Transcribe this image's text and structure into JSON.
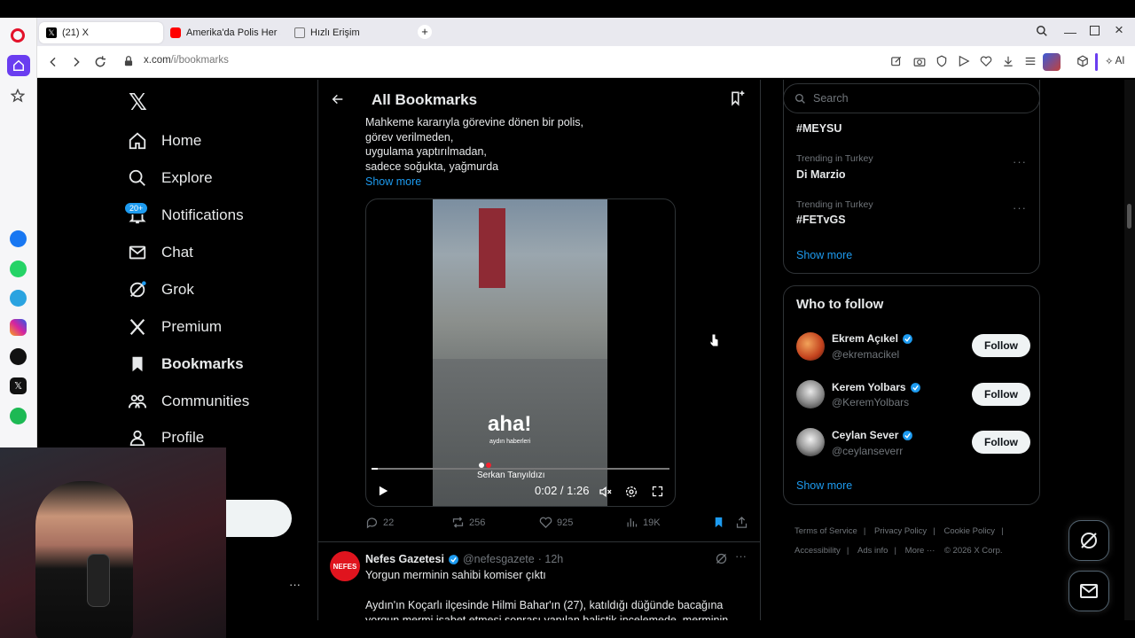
{
  "browser": {
    "tabs": [
      {
        "label": "(21) X"
      },
      {
        "label": "Amerika'da Polis Her Şeyi"
      },
      {
        "label": "Hızlı Erişim"
      }
    ],
    "url_host": "x.com",
    "url_path": "/i/bookmarks",
    "ai_label": "AI"
  },
  "nav": {
    "items": [
      {
        "label": "Home"
      },
      {
        "label": "Explore"
      },
      {
        "label": "Notifications"
      },
      {
        "label": "Chat"
      },
      {
        "label": "Grok"
      },
      {
        "label": "Premium"
      },
      {
        "label": "Bookmarks"
      },
      {
        "label": "Communities"
      },
      {
        "label": "Profile"
      }
    ],
    "notif_badge": "20+"
  },
  "main": {
    "title": "All Bookmarks",
    "tweet1": {
      "lines": [
        "Mahkeme kararıyla görevine dönen bir polis,",
        "görev verilmeden,",
        "uygulama yaptırılmadan,",
        "sadece soğukta, yağmurda"
      ],
      "show_more": "Show more",
      "video": {
        "watermark": "aha!",
        "watermark_sub": "aydın haberleri",
        "caption": "Serkan Tanyıldızı",
        "time": "0:02 / 1:26",
        "progress": 0.02
      },
      "actions": {
        "replies": "22",
        "reposts": "256",
        "likes": "925",
        "views": "19K"
      }
    },
    "tweet2": {
      "avatar_text": "NEFES",
      "name": "Nefes Gazetesi",
      "handle": "@nefesgazete",
      "time": "· 12h",
      "headline": "Yorgun merminin sahibi komiser çıktı",
      "body": "Aydın'ın Koçarlı ilçesinde Hilmi Bahar'ın (27), katıldığı düğünde bacağına",
      "body2": "yorgun mermi isabet etmesi sonrası yapılan balistik incelemede, merminin"
    }
  },
  "right": {
    "search_placeholder": "Search",
    "trends": [
      {
        "category": "",
        "name": "#MEYSU"
      },
      {
        "category": "Trending in Turkey",
        "name": "Di Marzio"
      },
      {
        "category": "Trending in Turkey",
        "name": "#FETvGS"
      }
    ],
    "trends_show_more": "Show more",
    "wtf_title": "Who to follow",
    "wtf": [
      {
        "name": "Ekrem Açıkel",
        "handle": "@ekremacikel",
        "button": "Follow"
      },
      {
        "name": "Kerem Yolbars",
        "handle": "@KeremYolbars",
        "button": "Follow"
      },
      {
        "name": "Ceylan Sever",
        "handle": "@ceylanseverr",
        "button": "Follow"
      }
    ],
    "wtf_show_more": "Show more",
    "footer": {
      "terms": "Terms of Service",
      "privacy": "Privacy Policy",
      "cookie": "Cookie Policy",
      "accessibility": "Accessibility",
      "ads": "Ads info",
      "more": "More ···",
      "copyright": "© 2026 X Corp."
    }
  },
  "colors": {
    "accent": "#1d9bf0",
    "bg": "#000000",
    "text": "#e7e9ea",
    "muted": "#71767b",
    "border": "#2f3336"
  }
}
